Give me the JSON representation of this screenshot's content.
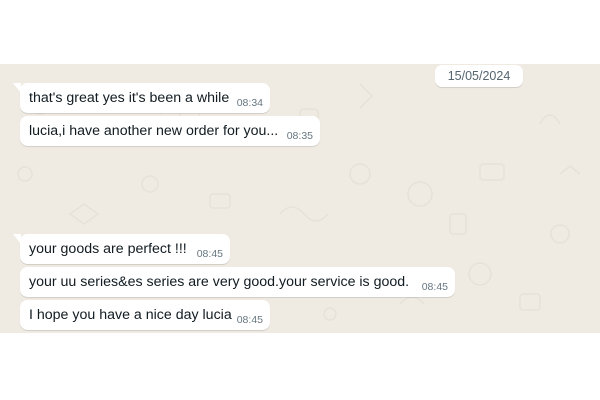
{
  "chat": {
    "date_chip": "15/05/2024",
    "messages": [
      {
        "text": "that's great yes it's been a while",
        "time": "08:34"
      },
      {
        "text": "lucia,i have another new order for you...",
        "time": "08:35"
      },
      {
        "text": "your goods are perfect !!!",
        "time": "08:45"
      },
      {
        "text": "your uu series&es series are very good.your service  is good.",
        "time": "08:45"
      },
      {
        "text": "I hope you have a nice day lucia",
        "time": "08:45"
      }
    ]
  },
  "colors": {
    "chat_background": "#efeae2",
    "bubble_background": "#ffffff",
    "message_text": "#111b21",
    "timestamp_text": "#667781"
  },
  "icons": {
    "background_pattern": "doodle-pattern-icon"
  }
}
